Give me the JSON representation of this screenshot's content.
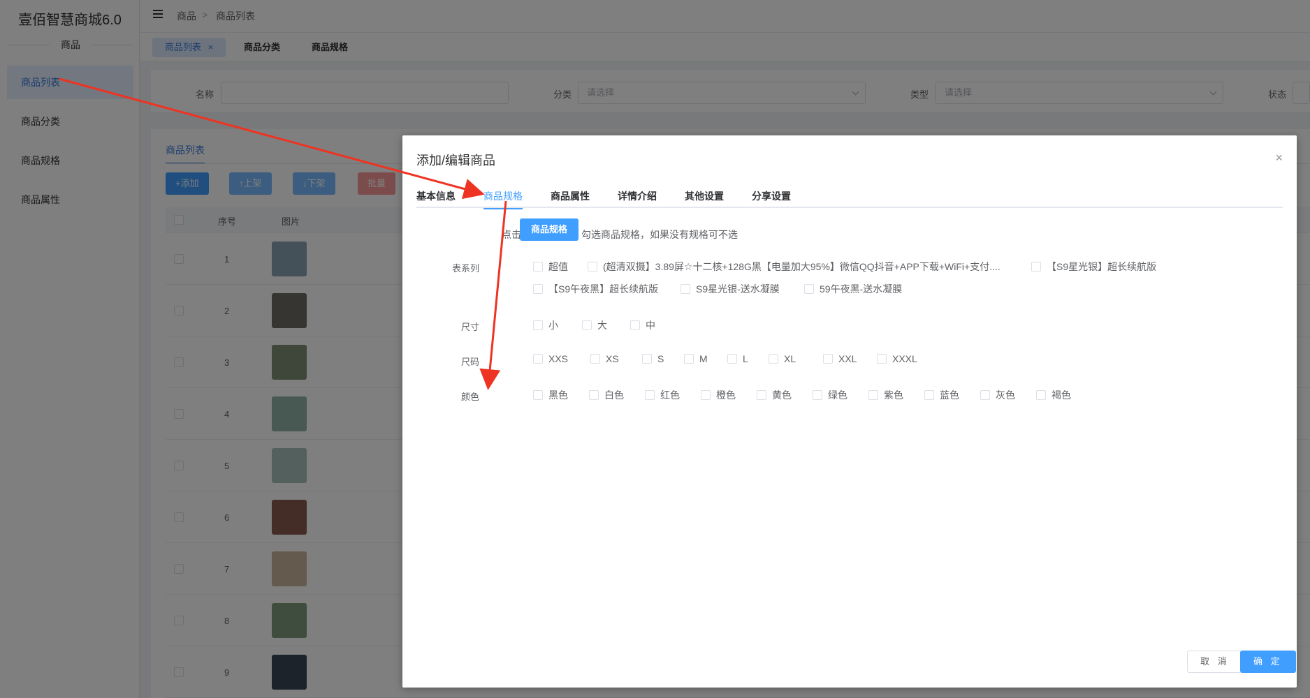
{
  "sidebar": {
    "brand": "壹佰智慧商城6.0",
    "section": "商品",
    "items": [
      {
        "label": "商品列表",
        "active": true
      },
      {
        "label": "商品分类",
        "active": false
      },
      {
        "label": "商品规格",
        "active": false
      },
      {
        "label": "商品属性",
        "active": false
      }
    ]
  },
  "header": {
    "breadcrumb": [
      "商品",
      ">",
      "商品列表"
    ]
  },
  "tags": [
    {
      "label": "商品列表",
      "closable": true,
      "active": true
    },
    {
      "label": "商品分类",
      "active": false
    },
    {
      "label": "商品规格",
      "active": false
    }
  ],
  "filters": {
    "name_label": "名称",
    "name_value": "",
    "category_label": "分类",
    "category_placeholder": "请选择",
    "type_label": "类型",
    "type_placeholder": "请选择",
    "status_label": "状态"
  },
  "list": {
    "tab": "商品列表",
    "buttons": [
      "+添加",
      "↑上架",
      "↓下架",
      "批量"
    ],
    "columns": [
      "序号",
      "图片"
    ],
    "rows": [
      "1",
      "2",
      "3",
      "4",
      "5",
      "6",
      "7",
      "8",
      "9"
    ]
  },
  "dialog": {
    "title": "添加/编辑商品",
    "close": "×",
    "tabs": [
      "基本信息",
      "商品规格",
      "商品属性",
      "详情介绍",
      "其他设置",
      "分享设置"
    ],
    "active_tab": "商品规格",
    "hint_prefix": "点击",
    "spec_button": "商品规格",
    "hint_suffix": "勾选商品规格，如果没有规格可不选",
    "groups": [
      {
        "label": "表系列",
        "options": [
          "超值",
          "(超清双摄】3.89屏☆十二核+128G黑【电量加大95%】微信QQ抖音+APP下载+WiFi+支付....",
          "【S9星光银】超长续航版",
          "【S9午夜黑】超长续航版",
          "S9星光银-送水凝膜",
          "59午夜黑-送水凝膜"
        ]
      },
      {
        "label": "尺寸",
        "options": [
          "小",
          "大",
          "中"
        ]
      },
      {
        "label": "尺码",
        "options": [
          "XXS",
          "XS",
          "S",
          "M",
          "L",
          "XL",
          "XXL",
          "XXXL"
        ]
      },
      {
        "label": "颜色",
        "options": [
          "黑色",
          "白色",
          "红色",
          "橙色",
          "黄色",
          "绿色",
          "紫色",
          "蓝色",
          "灰色",
          "褐色"
        ]
      }
    ],
    "cancel": "取 消",
    "confirm": "确 定"
  },
  "colors": {
    "primary": "#409eff",
    "annotation": "#ee3322"
  }
}
